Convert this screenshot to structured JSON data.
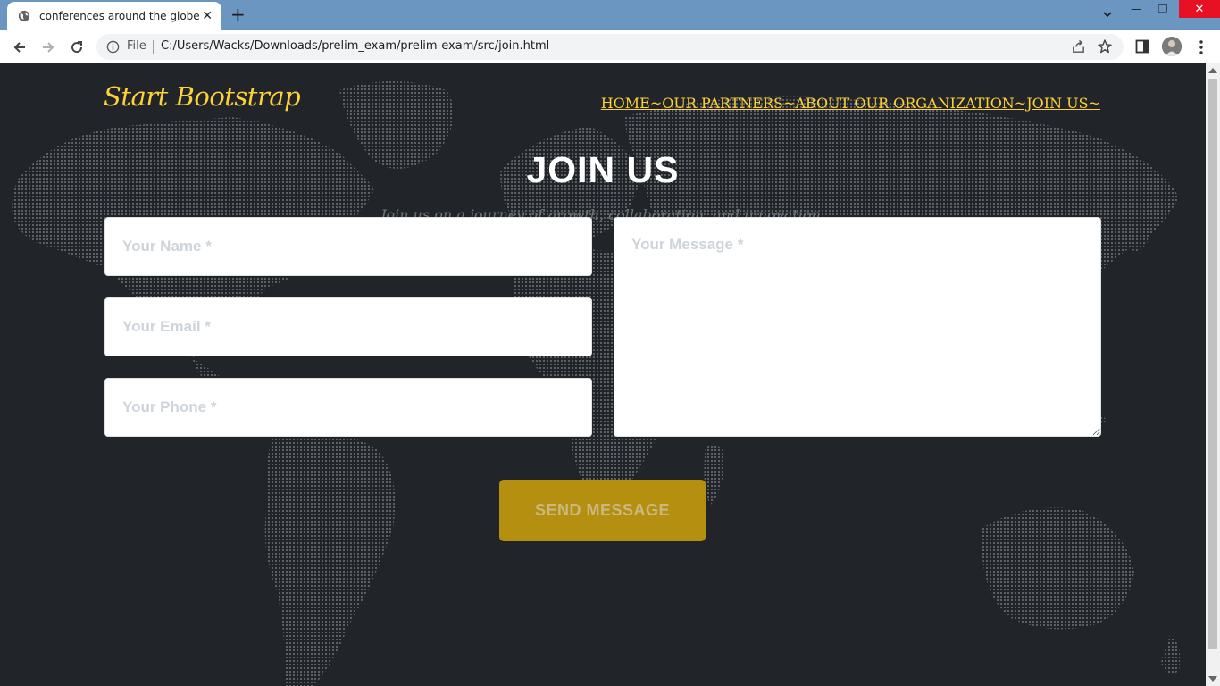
{
  "browser": {
    "tab_title": "conferences around the globe",
    "tab_close": "✕",
    "new_tab": "+",
    "address_scheme": "File",
    "address_url": "C:/Users/Wacks/Downloads/prelim_exam/prelim-exam/src/join.html",
    "window_min": "—",
    "window_max": "❐",
    "window_close": "✕"
  },
  "site": {
    "brand": "Start Bootstrap",
    "nav": "HOME~OUR PARTNERS~ABOUT OUR ORGANIZATION~JOIN US~",
    "colors": {
      "accent": "#fed136",
      "background": "#212529",
      "button": "#b58f10"
    }
  },
  "contact": {
    "heading": "JOIN US",
    "subheading": "Join us on a journey of growth, collaboration, and innovation.",
    "name_placeholder": "Your Name *",
    "email_placeholder": "Your Email *",
    "phone_placeholder": "Your Phone *",
    "message_placeholder": "Your Message *",
    "submit_label": "SEND MESSAGE"
  }
}
